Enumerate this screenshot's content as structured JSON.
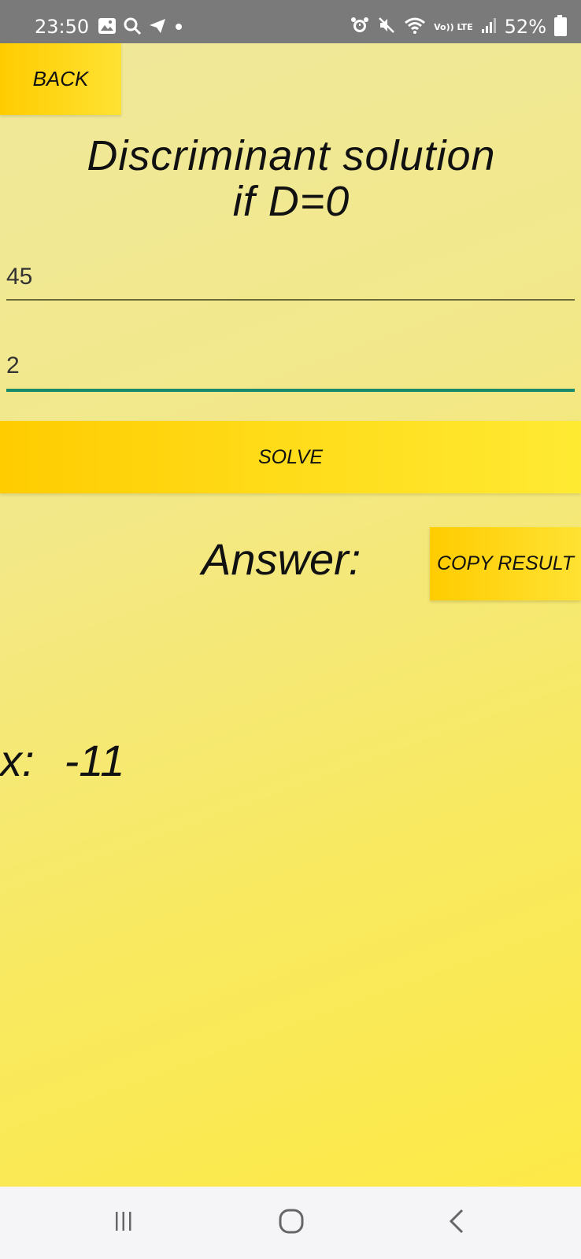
{
  "status_bar": {
    "time": "23:50",
    "left_icons": [
      "gallery-icon",
      "search-icon",
      "telegram-icon",
      "dot-icon"
    ],
    "right_icons": [
      "alarm-icon",
      "mute-icon",
      "wifi-icon",
      "volte-lte-icon",
      "signal-icon"
    ],
    "volte_label": "Vo)) LTE",
    "battery_text": "52%"
  },
  "app": {
    "back_label": "BACK",
    "title_line1": "Discriminant solution",
    "title_line2": "if D=0",
    "field1_value": "45",
    "field2_value": "2",
    "solve_label": "SOLVE",
    "answer_label": "Answer:",
    "copy_label": "COPY RESULT",
    "result_label": "x:",
    "result_value": "-11"
  },
  "colors": {
    "button": "#ffcc00",
    "focus_underline": "#1a8a6a",
    "underline": "#6b6b3a"
  },
  "nav_bar": {
    "buttons": [
      "recent-apps",
      "home",
      "back"
    ]
  }
}
